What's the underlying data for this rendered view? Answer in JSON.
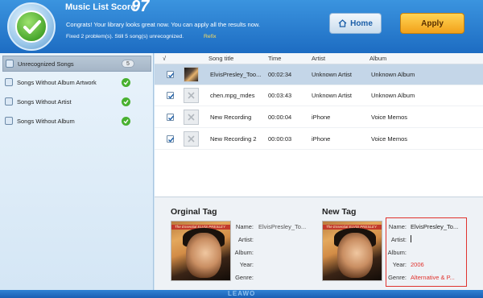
{
  "header": {
    "score_label": "Music List Score:",
    "score_value": "97",
    "message": "Congrats! Your library looks great now. You can apply all the results now.",
    "status": "Fixed 2 problem(s). Still 5 song(s) unrecognized.",
    "refix_label": "Refix",
    "home_label": "Home",
    "apply_label": "Apply"
  },
  "sidebar": {
    "items": [
      {
        "label": "Unrecognized Songs",
        "count": "5",
        "icon": "music-note-icon"
      },
      {
        "label": "Songs Without Album Artwork",
        "icon": "artwork-icon"
      },
      {
        "label": "Songs Without Artist",
        "icon": "artist-icon"
      },
      {
        "label": "Songs Without Album",
        "icon": "album-icon"
      }
    ]
  },
  "table": {
    "columns": [
      "√",
      "Song title",
      "Time",
      "Artist",
      "Album"
    ],
    "rows": [
      {
        "title": "ElvisPresley_Too...",
        "time": "00:02:34",
        "artist": "Unknown Artist",
        "album": "Unknown Album",
        "has_art": true,
        "checked": true
      },
      {
        "title": "chen.mpg_mdes",
        "time": "00:03:43",
        "artist": "Unknown Artist",
        "album": "Unknown Album",
        "has_art": false,
        "checked": true
      },
      {
        "title": "New Recording",
        "time": "00:00:04",
        "artist": "iPhone",
        "album": "Voice Memos",
        "has_art": false,
        "checked": true
      },
      {
        "title": "New Recording 2",
        "time": "00:00:03",
        "artist": "iPhone",
        "album": "Voice Memos",
        "has_art": false,
        "checked": true
      }
    ]
  },
  "original_tag": {
    "title": "Orginal Tag",
    "name_label": "Name:",
    "name_value": "ElvisPresley_To...",
    "artist_label": "Artist:",
    "album_label": "Album:",
    "year_label": "Year:",
    "genre_label": "Genre:",
    "cover_text": "The Essential ELVIS PRESLEY"
  },
  "new_tag": {
    "title": "New Tag",
    "name_label": "Name:",
    "name_value": "ElvisPresley_To...",
    "artist_label": "Artist:",
    "album_label": "Album:",
    "year_label": "Year:",
    "year_value": "2006",
    "genre_label": "Genre:",
    "genre_value": "Alternative & P..."
  },
  "footer": {
    "logo": "LEAWO"
  },
  "colors": {
    "header": "#1d6cc2",
    "apply": "#f2a11a",
    "highlight": "#e0332e",
    "check_ok": "#48b02f"
  }
}
